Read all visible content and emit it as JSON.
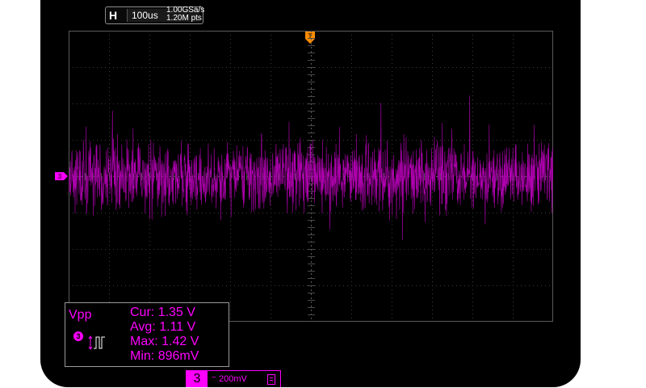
{
  "timebase": {
    "letter": "H",
    "scale": "100us",
    "sample_rate": "1.00GSa/s",
    "memory_depth": "1.20M pts"
  },
  "trigger": {
    "marker_icon": "trigger-t-icon",
    "label": "T"
  },
  "channel": {
    "number": "3",
    "color": "#ff00ff",
    "coupling_icon": "~",
    "scale": "200mV",
    "marker": "3"
  },
  "measurement": {
    "name": "Vpp",
    "source_icon": "channel-3-icon",
    "rows": [
      {
        "label": "Cur:",
        "value": "1.35 V"
      },
      {
        "label": "Avg:",
        "value": "1.11 V"
      },
      {
        "label": "Max:",
        "value": "1.42 V"
      },
      {
        "label": "Min:",
        "value": "896mV"
      }
    ]
  },
  "colors": {
    "screen": "#000000",
    "grid": "#4a4a4a",
    "trace": "#c000c0",
    "trigger": "#ff8c00"
  }
}
